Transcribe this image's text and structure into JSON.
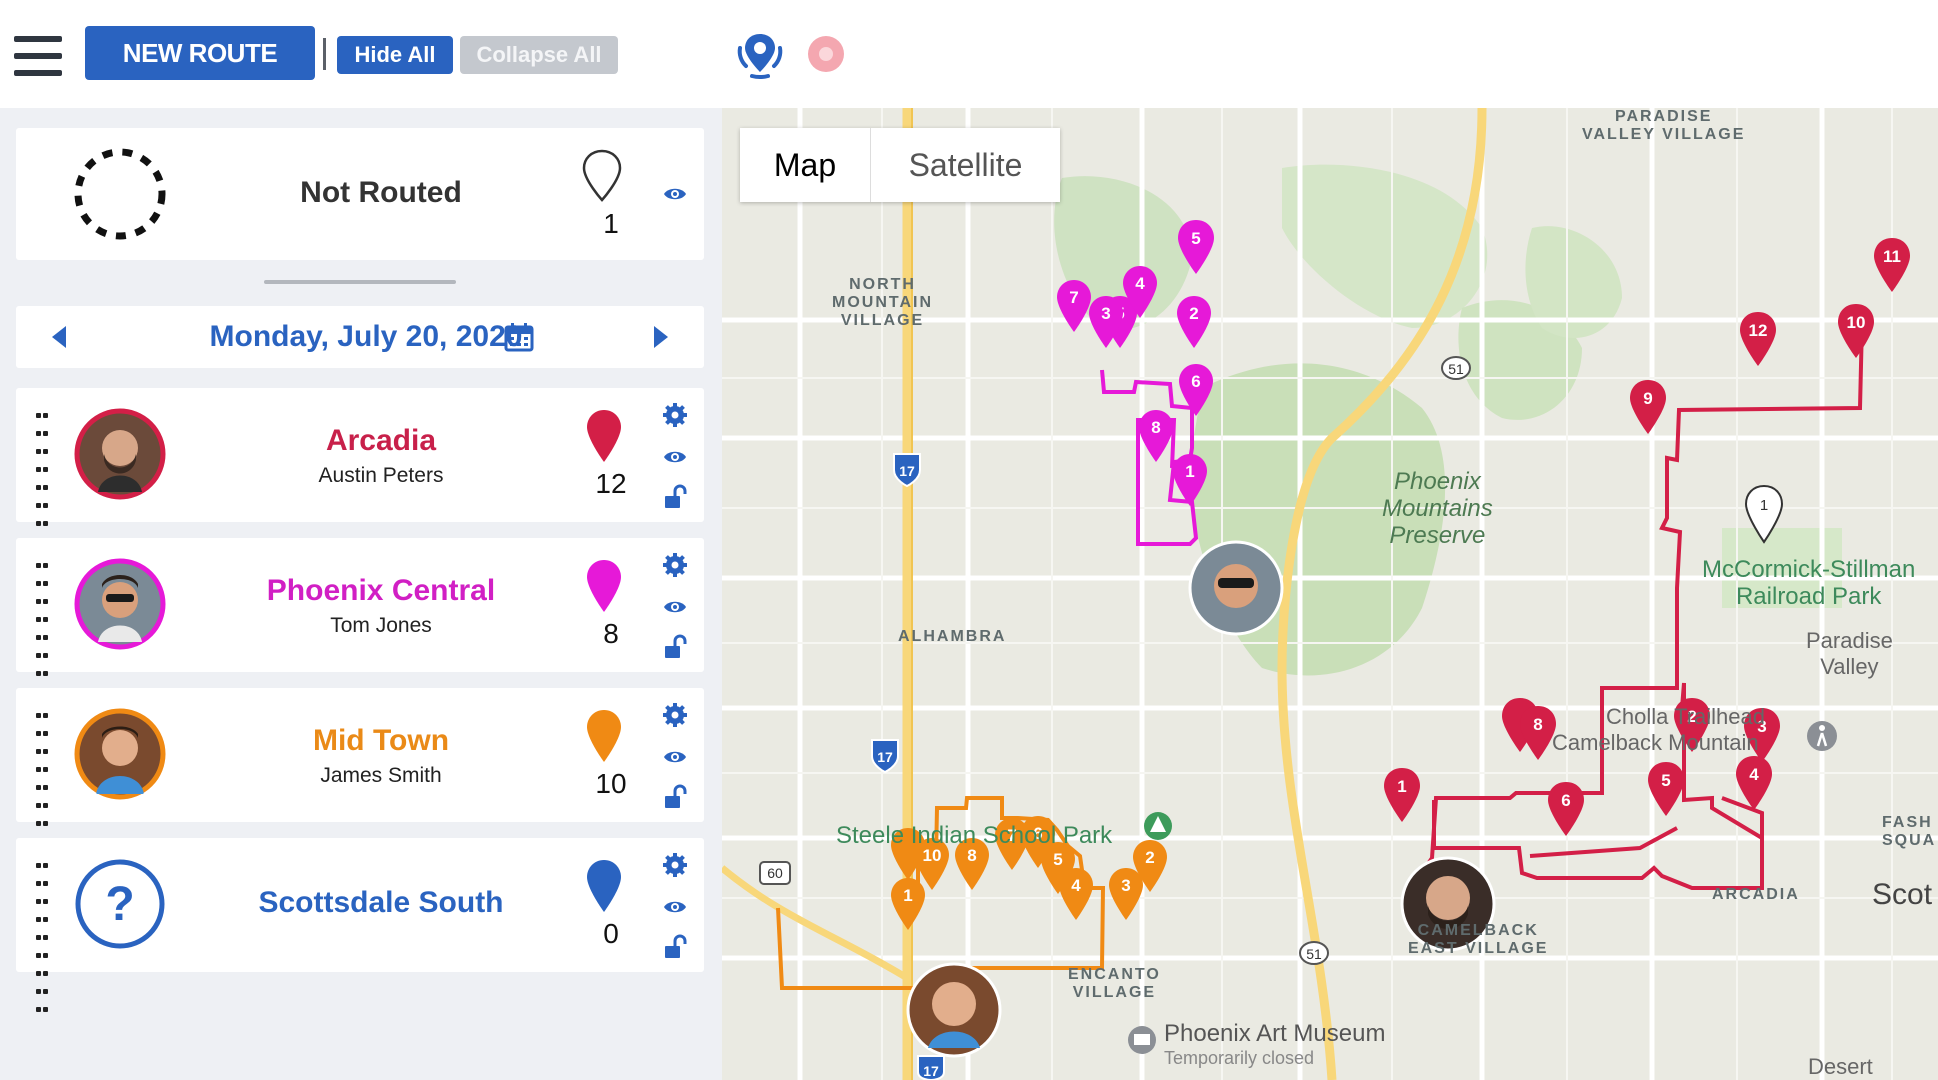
{
  "toolbar": {
    "new_route_label": "NEW ROUTE",
    "hide_all_label": "Hide All",
    "collapse_all_label": "Collapse All"
  },
  "not_routed": {
    "label": "Not Routed",
    "count": "1"
  },
  "date": {
    "label": "Monday, July 20, 2020"
  },
  "routes": [
    {
      "name": "Arcadia",
      "driver": "Austin Peters",
      "count": "12",
      "color": "#d31f47"
    },
    {
      "name": "Phoenix Central",
      "driver": "Tom Jones",
      "count": "8",
      "color": "#e619d8"
    },
    {
      "name": "Mid Town",
      "driver": "James Smith",
      "count": "10",
      "color": "#f08a14"
    },
    {
      "name": "Scottsdale South",
      "driver": "",
      "count": "0",
      "color": "#2a63c0"
    }
  ],
  "map": {
    "tabs": {
      "map": "Map",
      "satellite": "Satellite"
    },
    "labels": {
      "paradise_valley_village": "PARADISE\nVALLEY VILLAGE",
      "north_mountain": "NORTH\nMOUNTAIN\nVILLAGE",
      "alhambra": "ALHAMBRA",
      "phoenix_mountains": "Phoenix\nMountains\nPreserve",
      "mccormick": "McCormick-Stillman\nRailroad Park",
      "paradise_valley": "Paradise\nValley",
      "cholla": "Cholla Trailhead",
      "camelback": "Camelback Mountain",
      "steele": "Steele Indian School Park",
      "encanto": "ENCANTO\nVILLAGE",
      "art_museum": "Phoenix Art Museum",
      "art_museum_status": "Temporarily closed",
      "camelback_east": "CAMELBACK\nEAST VILLAGE",
      "arcadia": "ARCADIA",
      "scottsdale": "Scot",
      "fashion": "FASH\nSQUA",
      "desert": "Desert",
      "hw51": "51",
      "i17": "17",
      "us60": "60"
    }
  }
}
